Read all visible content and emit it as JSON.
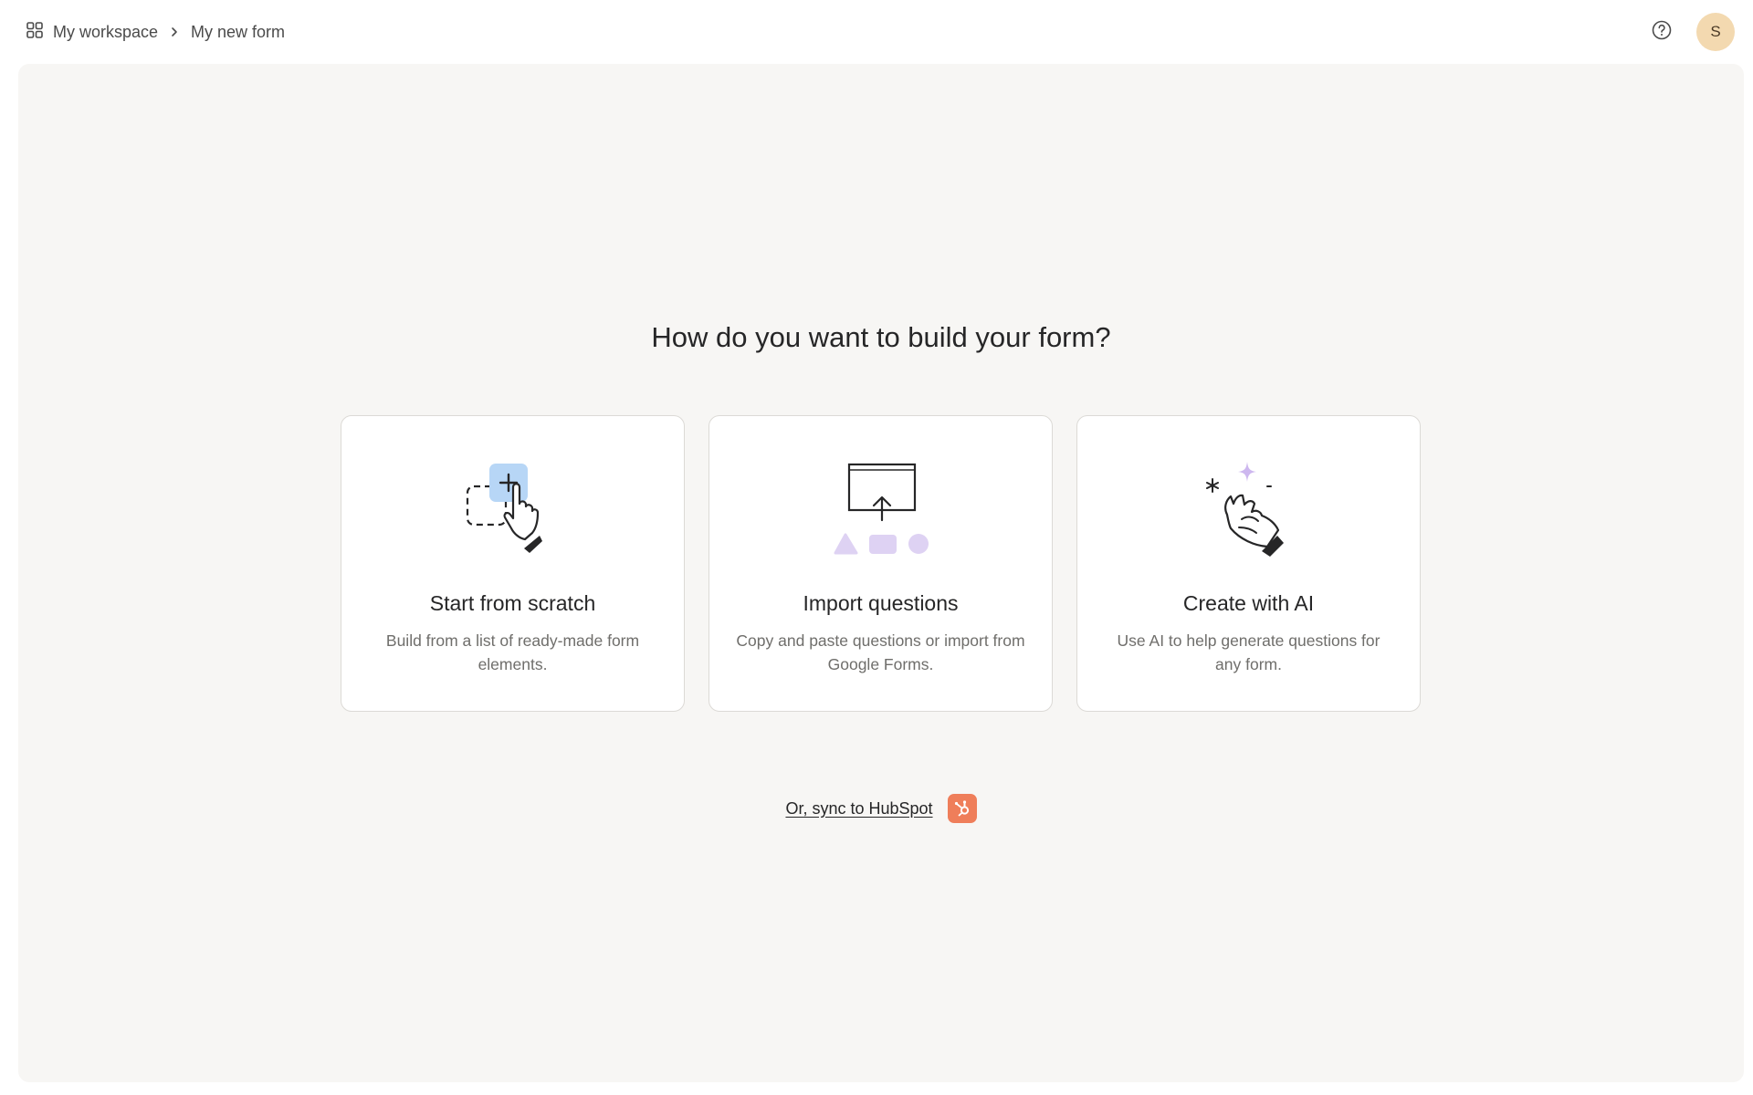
{
  "breadcrumb": {
    "workspace_icon": "grid-icon",
    "workspace": "My workspace",
    "separator_icon": "chevron-right-icon",
    "current": "My new form"
  },
  "header": {
    "help_icon": "help-circle-icon",
    "avatar_initial": "S",
    "avatar_color": "#f3d9b0"
  },
  "main": {
    "heading": "How do you want to build your form?",
    "options": [
      {
        "icon": "hand-click-plus-icon",
        "title": "Start from scratch",
        "description": "Build from a list of ready-made form elements."
      },
      {
        "icon": "import-upload-icon",
        "title": "Import questions",
        "description": "Copy and paste questions or import from Google Forms."
      },
      {
        "icon": "ai-sparkle-hand-icon",
        "title": "Create with AI",
        "description": "Use AI to help generate questions for any form."
      }
    ],
    "hubspot": {
      "label": "Or, sync to HubSpot",
      "icon": "hubspot-logo-icon",
      "color": "#ef7e5a"
    }
  }
}
